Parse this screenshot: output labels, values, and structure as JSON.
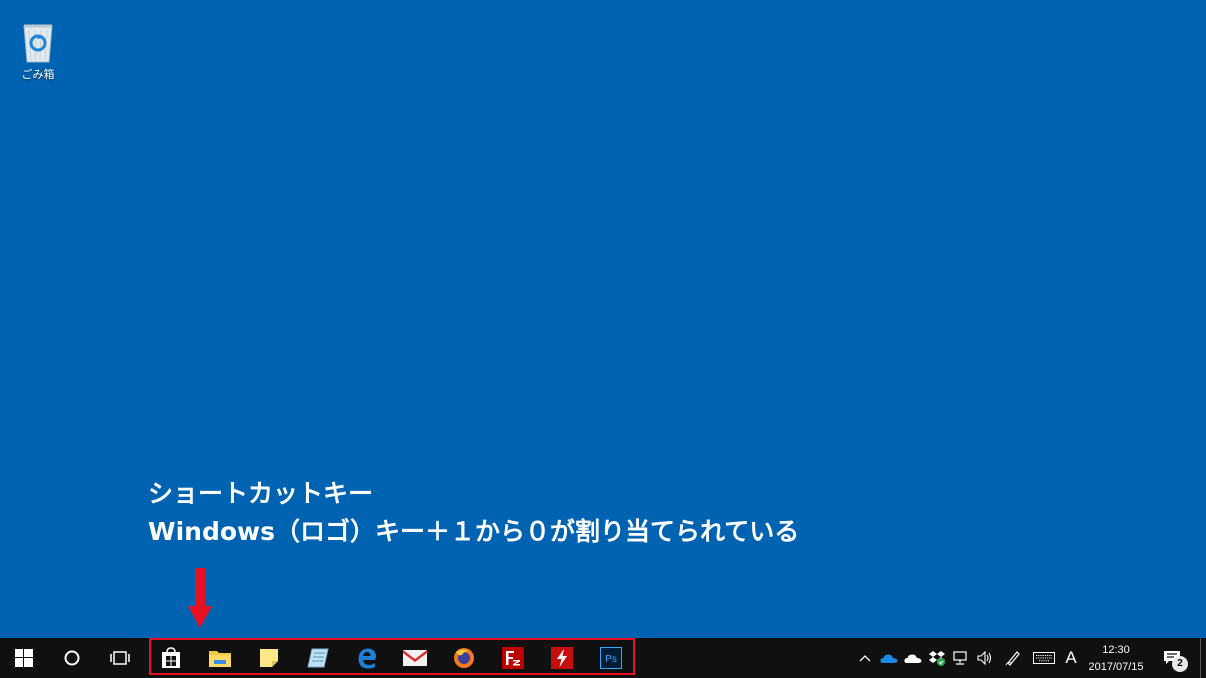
{
  "desktop": {
    "recycle_bin_label": "ごみ箱"
  },
  "annotation": {
    "line1": "ショートカットキー",
    "line2": "Windows（ロゴ）キー＋１から０が割り当てられている"
  },
  "taskbar": {
    "start": "windows-logo",
    "search": "cortana",
    "task_view": "task-view",
    "pinned_apps": [
      "store",
      "file-explorer",
      "sticky-notes",
      "notepad",
      "edge",
      "mail",
      "firefox",
      "filezilla",
      "flash",
      "photoshop"
    ],
    "photoshop_label": "Ps",
    "tray": {
      "time": "12:30",
      "date": "2017/07/15",
      "ime_mode": "A",
      "notification_count": "2"
    }
  },
  "colors": {
    "desktop": "#0063b1",
    "taskbar": "#101010",
    "highlight": "#e81123"
  }
}
